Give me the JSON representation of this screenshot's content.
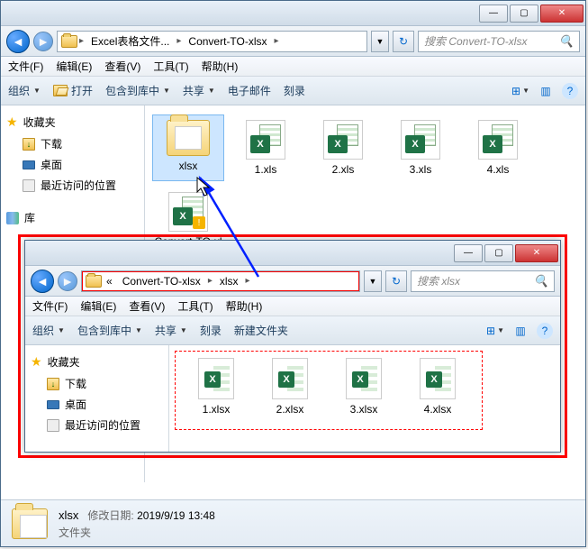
{
  "outer": {
    "breadcrumb": [
      "Excel表格文件...",
      "Convert-TO-xlsx"
    ],
    "search_placeholder": "搜索 Convert-TO-xlsx",
    "menus": [
      "文件(F)",
      "编辑(E)",
      "查看(V)",
      "工具(T)",
      "帮助(H)"
    ],
    "toolbar": {
      "organize": "组织",
      "open": "打开",
      "include": "包含到库中",
      "share": "共享",
      "email": "电子邮件",
      "burn": "刻录"
    },
    "sidebar": {
      "favorites": "收藏夹",
      "downloads": "下载",
      "desktop": "桌面",
      "recent": "最近访问的位置",
      "library": "库"
    },
    "files": [
      {
        "name": "xlsx",
        "type": "folder",
        "selected": true
      },
      {
        "name": "1.xls",
        "type": "xls"
      },
      {
        "name": "2.xls",
        "type": "xls"
      },
      {
        "name": "3.xls",
        "type": "xls"
      },
      {
        "name": "4.xls",
        "type": "xls"
      },
      {
        "name": "Convert-TO-xlsx.xlsm",
        "type": "xlsm"
      }
    ],
    "status": {
      "name": "xlsx",
      "date_label": "修改日期:",
      "date": "2019/9/19 13:48",
      "type": "文件夹"
    }
  },
  "inner": {
    "breadcrumb_prefix": "«",
    "breadcrumb": [
      "Convert-TO-xlsx",
      "xlsx"
    ],
    "search_placeholder": "搜索 xlsx",
    "menus": [
      "文件(F)",
      "编辑(E)",
      "查看(V)",
      "工具(T)",
      "帮助(H)"
    ],
    "toolbar": {
      "organize": "组织",
      "include": "包含到库中",
      "share": "共享",
      "burn": "刻录",
      "newfolder": "新建文件夹"
    },
    "sidebar": {
      "favorites": "收藏夹",
      "downloads": "下载",
      "desktop": "桌面",
      "recent": "最近访问的位置"
    },
    "files": [
      {
        "name": "1.xlsx"
      },
      {
        "name": "2.xlsx"
      },
      {
        "name": "3.xlsx"
      },
      {
        "name": "4.xlsx"
      }
    ]
  }
}
